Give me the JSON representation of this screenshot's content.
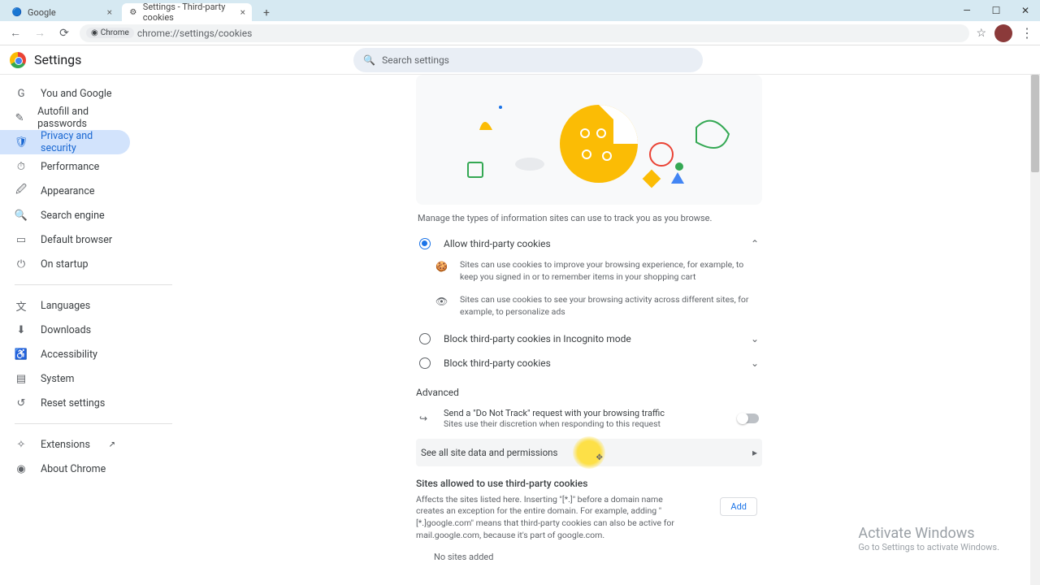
{
  "window": {
    "tabs": [
      {
        "title": "Google",
        "favicon": "G"
      },
      {
        "title": "Settings - Third-party cookies",
        "favicon": "gear"
      }
    ],
    "active_tab": 1
  },
  "addressbar": {
    "chip_label": "Chrome",
    "url": "chrome://settings/cookies"
  },
  "header": {
    "title": "Settings",
    "search_placeholder": "Search settings"
  },
  "sidebar": {
    "items": [
      {
        "label": "You and Google"
      },
      {
        "label": "Autofill and passwords"
      },
      {
        "label": "Privacy and security"
      },
      {
        "label": "Performance"
      },
      {
        "label": "Appearance"
      },
      {
        "label": "Search engine"
      },
      {
        "label": "Default browser"
      },
      {
        "label": "On startup"
      }
    ],
    "items2": [
      {
        "label": "Languages"
      },
      {
        "label": "Downloads"
      },
      {
        "label": "Accessibility"
      },
      {
        "label": "System"
      },
      {
        "label": "Reset settings"
      }
    ],
    "items3": [
      {
        "label": "Extensions"
      },
      {
        "label": "About Chrome"
      }
    ],
    "active_index": 2
  },
  "content": {
    "intro": "Manage the types of information sites can use to track you as you browse.",
    "radios": [
      {
        "label": "Allow third-party cookies",
        "checked": true,
        "expanded": true
      },
      {
        "label": "Block third-party cookies in Incognito mode",
        "checked": false,
        "expanded": false
      },
      {
        "label": "Block third-party cookies",
        "checked": false,
        "expanded": false
      }
    ],
    "radio1_sub": [
      "Sites can use cookies to improve your browsing experience, for example, to keep you signed in or to remember items in your shopping cart",
      "Sites can use cookies to see your browsing activity across different sites, for example, to personalize ads"
    ],
    "advanced_title": "Advanced",
    "dnt_title": "Send a \"Do Not Track\" request with your browsing traffic",
    "dnt_desc": "Sites use their discretion when responding to this request",
    "dnt_enabled": false,
    "see_all": "See all site data and permissions",
    "sites_allowed_title": "Sites allowed to use third-party cookies",
    "sites_allowed_desc": "Affects the sites listed here. Inserting \"[*.]\" before a domain name creates an exception for the entire domain. For example, adding \"[*.]google.com\" means that third-party cookies can also be active for mail.google.com, because it's part of google.com.",
    "add_label": "Add",
    "no_sites": "No sites added"
  },
  "watermark": {
    "title": "Activate Windows",
    "desc": "Go to Settings to activate Windows."
  }
}
